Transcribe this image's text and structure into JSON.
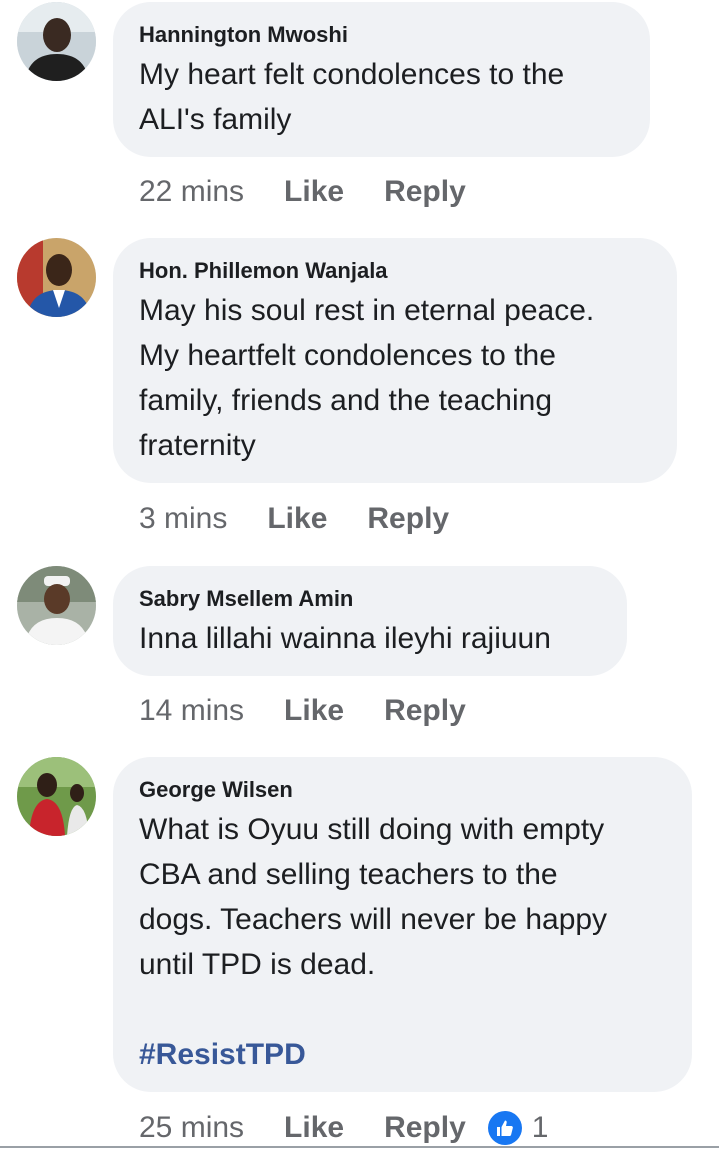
{
  "comments": [
    {
      "author": "Hannington Mwoshi",
      "text": "My heart felt condolences to the\nALI's family",
      "time": "22 mins",
      "like_label": "Like",
      "reply_label": "Reply"
    },
    {
      "author": "Hon. Phillemon Wanjala",
      "text": "May his soul rest in eternal peace.\nMy heartfelt condolences to the\nfamily,  friends and the teaching\nfraternity",
      "time": "3 mins",
      "like_label": "Like",
      "reply_label": "Reply"
    },
    {
      "author": "Sabry Msellem Amin",
      "text": "Inna lillahi wainna ileyhi rajiuun",
      "time": "14 mins",
      "like_label": "Like",
      "reply_label": "Reply"
    },
    {
      "author": "George Wilsen",
      "text": "What is Oyuu still doing with empty\nCBA and selling teachers to the\ndogs. Teachers will never be happy\nuntil TPD is dead.",
      "hashtag": "#ResistTPD",
      "time": "25 mins",
      "like_label": "Like",
      "reply_label": "Reply",
      "reaction_icon": "like-icon",
      "reaction_count": "1"
    }
  ],
  "colors": {
    "bubble": "#f0f2f5",
    "hashtag": "#385898",
    "like_reaction": "#1877f2",
    "meta_text": "#65676b"
  }
}
